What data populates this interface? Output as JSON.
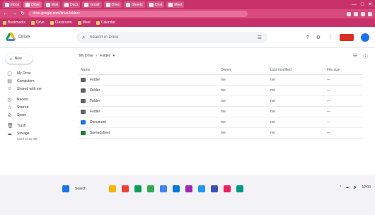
{
  "browser": {
    "tabs": [
      {
        "label": "Inbox"
      },
      {
        "label": "Drive",
        "active": true
      },
      {
        "label": "Mail"
      },
      {
        "label": "Docs"
      },
      {
        "label": "Gmail"
      },
      {
        "label": "Drive"
      },
      {
        "label": "Sheets"
      },
      {
        "label": "Chat"
      },
      {
        "label": "Meet"
      }
    ],
    "window_controls": [
      "—",
      "□",
      "✕"
    ],
    "url": "drive.google.com/drive/folders",
    "bookmarks": [
      "Bookmarks",
      "Drive",
      "Classroom",
      "Meet",
      "Calendar"
    ]
  },
  "drive": {
    "logo_text": "Drive",
    "search_placeholder": "Search in Drive",
    "new_label": "New"
  },
  "sidebar": {
    "items": [
      {
        "icon": "my-drive-icon",
        "glyph": "▢",
        "label": "My Drive"
      },
      {
        "icon": "computers-icon",
        "glyph": "▤",
        "label": "Computers"
      },
      {
        "icon": "shared-icon",
        "glyph": "☺",
        "label": "Shared with me"
      },
      {
        "icon": "recent-icon",
        "glyph": "◷",
        "label": "Recent"
      },
      {
        "icon": "starred-icon",
        "glyph": "☆",
        "label": "Starred"
      },
      {
        "icon": "spam-icon",
        "glyph": "⊘",
        "label": "Spam"
      },
      {
        "icon": "trash-icon",
        "glyph": "🗑",
        "label": "Trash"
      }
    ],
    "storage_label": "Storage",
    "storage_sub": "used of 15 GB"
  },
  "main": {
    "breadcrumb": [
      "My Drive",
      "›",
      "Folder",
      "▾"
    ],
    "columns": [
      "Name",
      "Owner",
      "Last modified",
      "File size"
    ],
    "rows": [
      {
        "type": "folder",
        "name": "Folder",
        "owner": "me",
        "modified": "me",
        "size": "—"
      },
      {
        "type": "folder",
        "name": "Folder",
        "owner": "me",
        "modified": "me",
        "size": "—"
      },
      {
        "type": "folder",
        "name": "Folder",
        "owner": "me",
        "modified": "me",
        "size": "—"
      },
      {
        "type": "folder",
        "name": "Folder",
        "owner": "me",
        "modified": "me",
        "size": "—"
      },
      {
        "type": "doc",
        "name": "Document",
        "owner": "me",
        "modified": "me",
        "size": "—"
      },
      {
        "type": "sheet",
        "name": "Spreadsheet",
        "owner": "me",
        "modified": "me",
        "size": "—"
      }
    ]
  },
  "taskbar": {
    "weather_line1": "",
    "weather_line2": "",
    "search_label": "Search",
    "icons": [
      {
        "name": "start-icon",
        "color": "#1a73e8"
      },
      {
        "name": "file-explorer-icon",
        "color": "#f4b400"
      },
      {
        "name": "chrome-icon",
        "color": "#ea4335"
      },
      {
        "name": "edge-icon",
        "color": "#0f9d58"
      },
      {
        "name": "chrome-icon",
        "color": "#34a853"
      },
      {
        "name": "store-icon",
        "color": "#4285f4"
      },
      {
        "name": "mail-icon",
        "color": "#0078d4"
      },
      {
        "name": "photos-icon",
        "color": "#9c27b0"
      },
      {
        "name": "app-icon",
        "color": "#2196f3"
      },
      {
        "name": "app-icon",
        "color": "#3f51b5"
      },
      {
        "name": "app-icon",
        "color": "#e91e63"
      },
      {
        "name": "app-icon",
        "color": "#009688"
      }
    ],
    "tray": [
      "^",
      "☁",
      "🔊",
      "12:00"
    ]
  }
}
